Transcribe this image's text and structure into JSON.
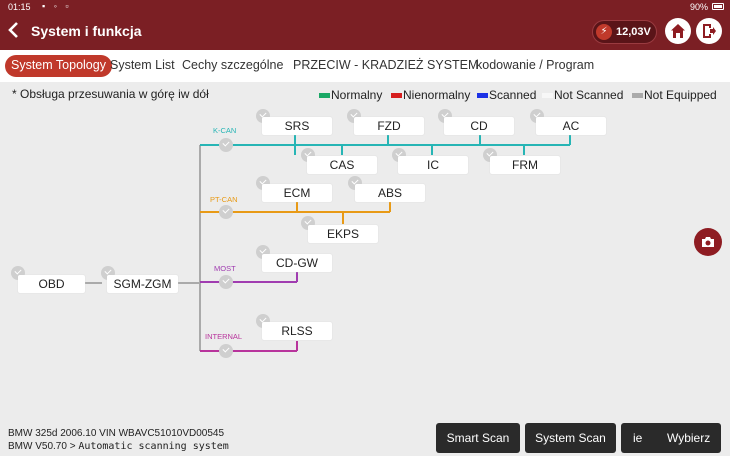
{
  "status": {
    "time": "01:15",
    "battery_pct": "90%"
  },
  "header": {
    "title": "System i funkcja",
    "voltage": "12,03V"
  },
  "tabs": [
    {
      "label": "System Topology",
      "active": true
    },
    {
      "label": "System List"
    },
    {
      "label": "Cechy szczególne"
    },
    {
      "label": "PRZECIW - KRADZIEŻ SYSTEM"
    },
    {
      "label": "kodowanie / Program"
    }
  ],
  "note": "* Obsługa przesuwania w górę iw dół",
  "legend": [
    {
      "label": "Normalny",
      "color": "#1aa866"
    },
    {
      "label": "Nienormalny",
      "color": "#d61e1e"
    },
    {
      "label": "Scanned",
      "color": "#1d32e6"
    },
    {
      "label": "Not Scanned",
      "color": "#f7f7f7"
    },
    {
      "label": "Not Equipped",
      "color": "#aaaaaa"
    }
  ],
  "buses": {
    "kcan": {
      "label": "K-CAN",
      "color": "#27b5b5"
    },
    "ptcan": {
      "label": "PT-CAN",
      "color": "#e89a16"
    },
    "most": {
      "label": "MOST",
      "color": "#a03cb0"
    },
    "internal": {
      "label": "INTERNAL",
      "color": "#b8349c"
    }
  },
  "nodes": {
    "obd": "OBD",
    "gateway": "SGM-ZGM",
    "srs": "SRS",
    "fzd": "FZD",
    "cd": "CD",
    "ac": "AC",
    "cas": "CAS",
    "ic": "IC",
    "frm": "FRM",
    "ecm": "ECM",
    "abs": "ABS",
    "ekps": "EKPS",
    "cdgw": "CD-GW",
    "rlss": "RLSS"
  },
  "vehicle": {
    "line1": "BMW  325d  2006.10  VIN  WBAVC51010VD00545",
    "line2_prefix": "BMW V50.70 >",
    "line2_path": "Automatic scanning system"
  },
  "footer_buttons": {
    "smart_scan": "Smart Scan",
    "system_scan": "System Scan",
    "ie": "ie",
    "select": "Wybierz"
  }
}
